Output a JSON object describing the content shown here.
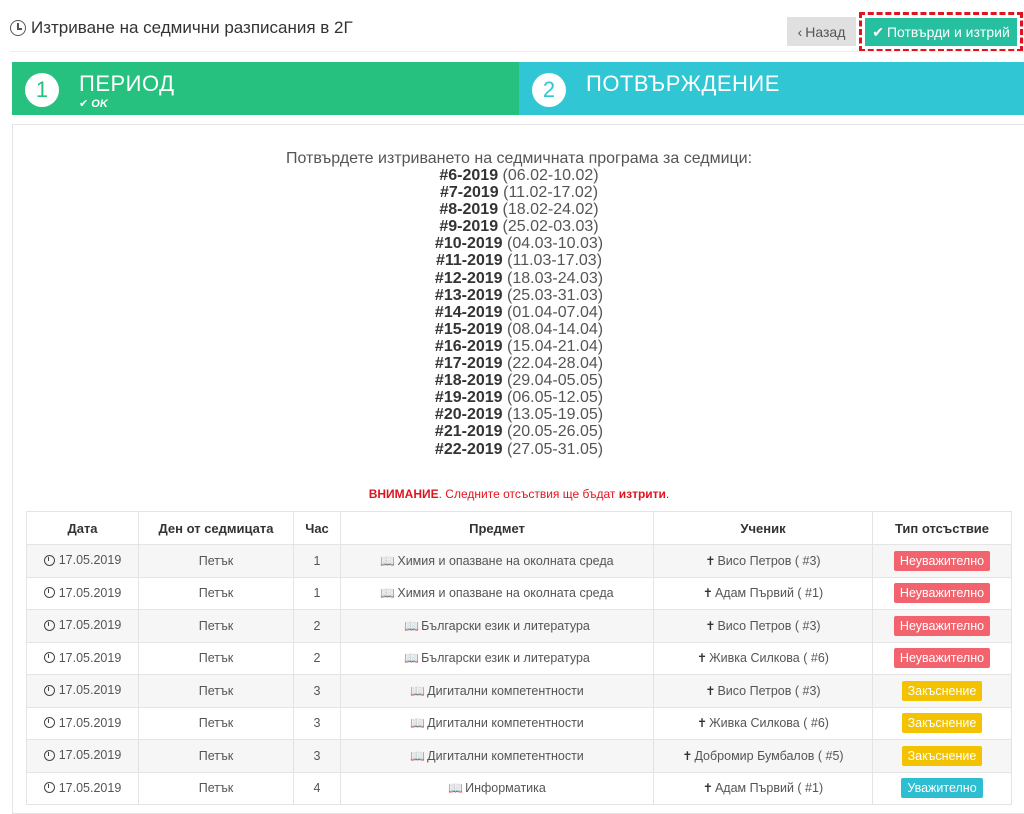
{
  "header": {
    "title": "Изтриване на седмични разписания в 2Г",
    "back_label": "Назад",
    "confirm_label": "Потвърди и изтрий"
  },
  "steps": [
    {
      "number": "1",
      "label": "ПЕРИОД",
      "status": "OK"
    },
    {
      "number": "2",
      "label": "ПОТВЪРЖДЕНИЕ"
    }
  ],
  "confirm_text": "Потвърдете изтриването на седмичната програма за седмици:",
  "weeks": [
    {
      "code": "#6-2019",
      "range": "(06.02-10.02)"
    },
    {
      "code": "#7-2019",
      "range": "(11.02-17.02)"
    },
    {
      "code": "#8-2019",
      "range": "(18.02-24.02)"
    },
    {
      "code": "#9-2019",
      "range": "(25.02-03.03)"
    },
    {
      "code": "#10-2019",
      "range": "(04.03-10.03)"
    },
    {
      "code": "#11-2019",
      "range": "(11.03-17.03)"
    },
    {
      "code": "#12-2019",
      "range": "(18.03-24.03)"
    },
    {
      "code": "#13-2019",
      "range": "(25.03-31.03)"
    },
    {
      "code": "#14-2019",
      "range": "(01.04-07.04)"
    },
    {
      "code": "#15-2019",
      "range": "(08.04-14.04)"
    },
    {
      "code": "#16-2019",
      "range": "(15.04-21.04)"
    },
    {
      "code": "#17-2019",
      "range": "(22.04-28.04)"
    },
    {
      "code": "#18-2019",
      "range": "(29.04-05.05)"
    },
    {
      "code": "#19-2019",
      "range": "(06.05-12.05)"
    },
    {
      "code": "#20-2019",
      "range": "(13.05-19.05)"
    },
    {
      "code": "#21-2019",
      "range": "(20.05-26.05)"
    },
    {
      "code": "#22-2019",
      "range": "(27.05-31.05)"
    }
  ],
  "warning": {
    "prefix": "ВНИМАНИЕ",
    "middle": ". Следните отсъствия ще бъдат ",
    "emph": "изтрити",
    "suffix": "."
  },
  "table": {
    "headers": [
      "Дата",
      "Ден от седмицата",
      "Час",
      "Предмет",
      "Ученик",
      "Тип отсъствие"
    ],
    "rows": [
      {
        "date": "17.05.2019",
        "day": "Петък",
        "hour": "1",
        "subject": "Химия и опазване на околната среда",
        "student": "Висо Петров ( #3)",
        "type": "Неуважително",
        "type_color": "red"
      },
      {
        "date": "17.05.2019",
        "day": "Петък",
        "hour": "1",
        "subject": "Химия и опазване на околната среда",
        "student": "Адам Първий ( #1)",
        "type": "Неуважително",
        "type_color": "red"
      },
      {
        "date": "17.05.2019",
        "day": "Петък",
        "hour": "2",
        "subject": "Български език и литература",
        "student": "Висо Петров ( #3)",
        "type": "Неуважително",
        "type_color": "red"
      },
      {
        "date": "17.05.2019",
        "day": "Петък",
        "hour": "2",
        "subject": "Български език и литература",
        "student": "Живка Силкова ( #6)",
        "type": "Неуважително",
        "type_color": "red"
      },
      {
        "date": "17.05.2019",
        "day": "Петък",
        "hour": "3",
        "subject": "Дигитални компетентности",
        "student": "Висо Петров ( #3)",
        "type": "Закъснение",
        "type_color": "yellow"
      },
      {
        "date": "17.05.2019",
        "day": "Петък",
        "hour": "3",
        "subject": "Дигитални компетентности",
        "student": "Живка Силкова ( #6)",
        "type": "Закъснение",
        "type_color": "yellow"
      },
      {
        "date": "17.05.2019",
        "day": "Петък",
        "hour": "3",
        "subject": "Дигитални компетентности",
        "student": "Добромир Бумбалов ( #5)",
        "type": "Закъснение",
        "type_color": "yellow"
      },
      {
        "date": "17.05.2019",
        "day": "Петък",
        "hour": "4",
        "subject": "Информатика",
        "student": "Адам Първий ( #1)",
        "type": "Уважително",
        "type_color": "cyan"
      }
    ]
  },
  "colors": {
    "step1": "#27c17f",
    "step2": "#30c6d4",
    "confirm_button": "#26bfa0",
    "highlight_border": "#e0141e",
    "badge_red": "#f2636d",
    "badge_yellow": "#f3c200",
    "badge_cyan": "#2dbfd1"
  },
  "icons": {
    "title": "clock-icon",
    "back": "chevron-left-icon",
    "confirm": "check-icon",
    "date": "clock-icon",
    "subject": "book-icon",
    "student": "person-icon"
  }
}
